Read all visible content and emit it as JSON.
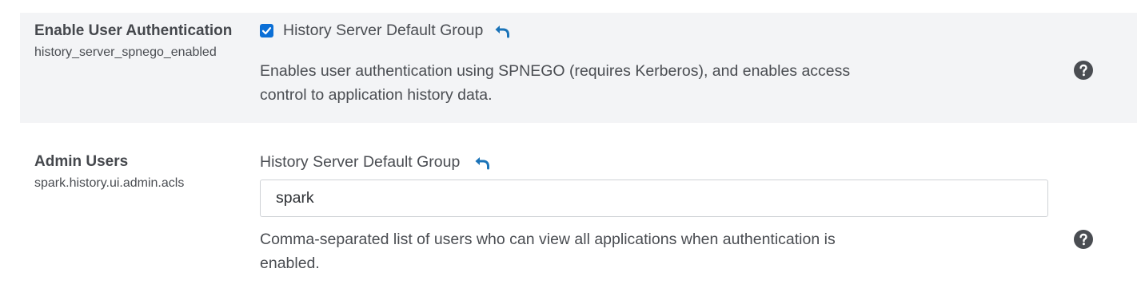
{
  "settings": [
    {
      "name": "Enable User Authentication",
      "key": "history_server_spnego_enabled",
      "group": "History Server Default Group",
      "checked": true,
      "description_line1": "Enables user authentication using SPNEGO (requires Kerberos), and enables access",
      "description_line2": "control to application history data.",
      "undo_icon": "undo-icon",
      "help_icon": "question-circle-icon"
    },
    {
      "name": "Admin Users",
      "key": "spark.history.ui.admin.acls",
      "group": "History Server Default Group",
      "value": "spark",
      "description_line1": "Comma-separated list of users who can view all applications when authentication is",
      "description_line2": "enabled.",
      "undo_icon": "undo-icon",
      "help_icon": "question-circle-icon"
    }
  ],
  "colors": {
    "row_highlight": "#f3f4f6",
    "accent": "#0b6fd6",
    "undo_icon": "#1a73b8",
    "help_icon": "#4a4d52"
  }
}
